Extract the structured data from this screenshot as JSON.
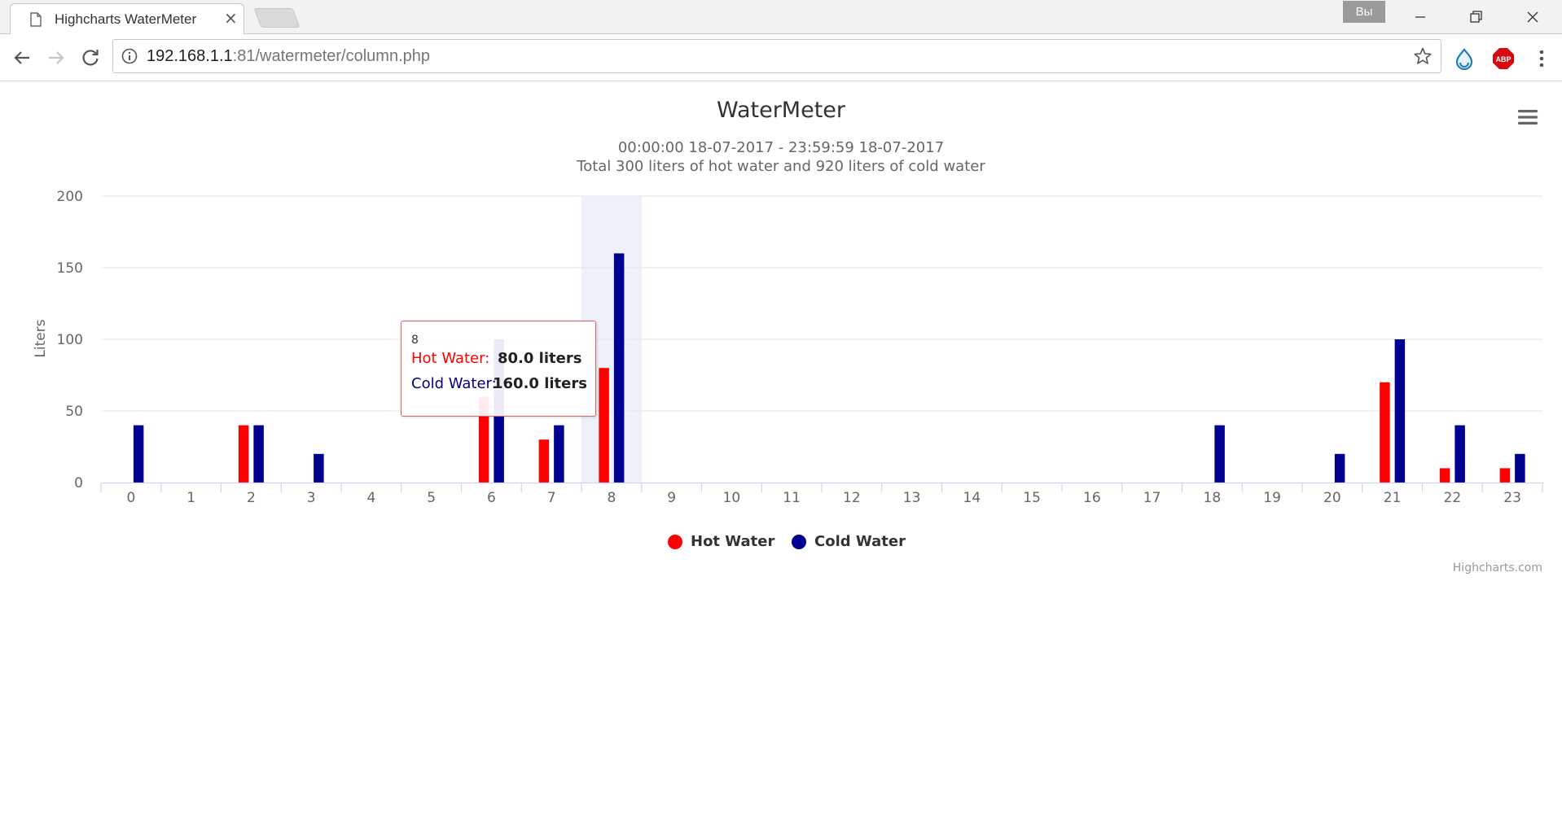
{
  "browser": {
    "tab_title": "Highcharts WaterMeter",
    "tab_close": "×",
    "profile_label": "Вы",
    "url_host": "192.168.1.1",
    "url_rest": ":81/watermeter/column.php",
    "extension_abp": "ABP"
  },
  "colors": {
    "hot": "#ff0000",
    "cold": "#000090",
    "grid": "#e6e6e6",
    "axis_text": "#666666",
    "hover_band": "#eef1f8"
  },
  "chart_data": {
    "type": "bar",
    "title": "WaterMeter",
    "subtitle_line1": "00:00:00 18-07-2017 - 23:59:59 18-07-2017",
    "subtitle_line2": "Total 300 liters of hot water and 920 liters of cold water",
    "ylabel": "Liters",
    "ylim": [
      0,
      200
    ],
    "yticks": [
      0,
      50,
      100,
      150,
      200
    ],
    "categories": [
      "0",
      "1",
      "2",
      "3",
      "4",
      "5",
      "6",
      "7",
      "8",
      "9",
      "10",
      "11",
      "12",
      "13",
      "14",
      "15",
      "16",
      "17",
      "18",
      "19",
      "20",
      "21",
      "22",
      "23"
    ],
    "series": [
      {
        "name": "Hot Water",
        "values": [
          0,
          0,
          40,
          0,
          0,
          0,
          60,
          30,
          80,
          0,
          0,
          0,
          0,
          0,
          0,
          0,
          0,
          0,
          0,
          0,
          0,
          70,
          10,
          10
        ]
      },
      {
        "name": "Cold Water",
        "values": [
          40,
          0,
          40,
          20,
          0,
          0,
          100,
          40,
          160,
          0,
          0,
          0,
          0,
          0,
          0,
          0,
          0,
          0,
          40,
          0,
          20,
          100,
          40,
          20
        ]
      }
    ],
    "highlighted_category": "8",
    "legend_position": "bottom-center",
    "grid": true,
    "tooltip": {
      "header": "8",
      "hot_label": "Hot Water:",
      "hot_value": "80.0 liters",
      "cold_label": "Cold Water:",
      "cold_value": "160.0 liters"
    },
    "credit": "Highcharts.com"
  }
}
